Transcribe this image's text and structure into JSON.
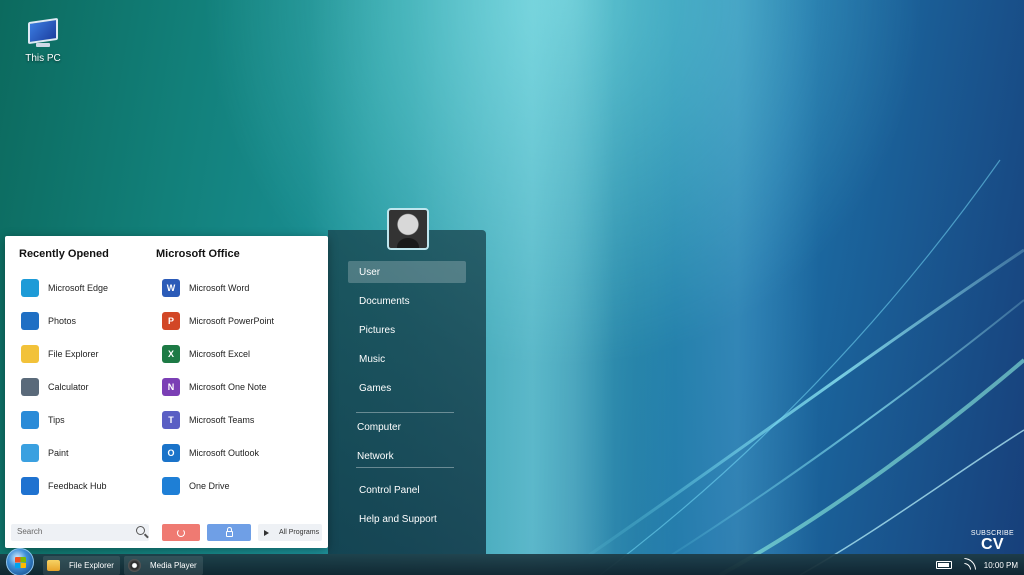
{
  "desktop": {
    "icons": [
      {
        "label": "This PC",
        "icon": "monitor-icon"
      }
    ]
  },
  "start_menu": {
    "left": {
      "recently_opened_title": "Recently Opened",
      "office_title": "Microsoft Office",
      "recent_apps": [
        {
          "label": "Microsoft Edge",
          "icon": "edge-icon",
          "color": "#1d9bd7"
        },
        {
          "label": "Photos",
          "icon": "photos-icon",
          "color": "#1f6fc4"
        },
        {
          "label": "File Explorer",
          "icon": "folder-icon",
          "color": "#f2c23a"
        },
        {
          "label": "Calculator",
          "icon": "calculator-icon",
          "color": "#5a6a7a"
        },
        {
          "label": "Tips",
          "icon": "tips-icon",
          "color": "#2a8bd8"
        },
        {
          "label": "Paint",
          "icon": "paint-icon",
          "color": "#3aa0e0"
        },
        {
          "label": "Feedback Hub",
          "icon": "feedback-icon",
          "color": "#1f72d0"
        }
      ],
      "office_apps": [
        {
          "label": "Microsoft Word",
          "icon": "word-icon",
          "letter": "W",
          "color": "#2b5bb8"
        },
        {
          "label": "Microsoft PowerPoint",
          "icon": "powerpoint-icon",
          "letter": "P",
          "color": "#d24726"
        },
        {
          "label": "Microsoft Excel",
          "icon": "excel-icon",
          "letter": "X",
          "color": "#1d7a45"
        },
        {
          "label": "Microsoft One Note",
          "icon": "onenote-icon",
          "letter": "N",
          "color": "#7b3fb5"
        },
        {
          "label": "Microsoft Teams",
          "icon": "teams-icon",
          "letter": "T",
          "color": "#5a5fc4"
        },
        {
          "label": "Microsoft Outlook",
          "icon": "outlook-icon",
          "letter": "O",
          "color": "#1a73c9"
        },
        {
          "label": "One Drive",
          "icon": "onedrive-icon",
          "letter": "",
          "color": "#1e7fd6"
        }
      ],
      "search_placeholder": "Search",
      "all_programs": "All Programs"
    },
    "right": {
      "places": [
        "User",
        "Documents",
        "Pictures",
        "Music",
        "Games"
      ],
      "places2": [
        "Computer",
        "Network"
      ],
      "places3": [
        "Control Panel",
        "Help and Support"
      ]
    }
  },
  "taskbar": {
    "buttons": [
      {
        "label": "File Explorer",
        "icon": "folder-icon"
      },
      {
        "label": "Media Player",
        "icon": "media-player-icon"
      }
    ],
    "clock": "10:00 PM"
  },
  "watermark": {
    "subscribe": "SUBSCRIBE",
    "logo": "CV"
  }
}
